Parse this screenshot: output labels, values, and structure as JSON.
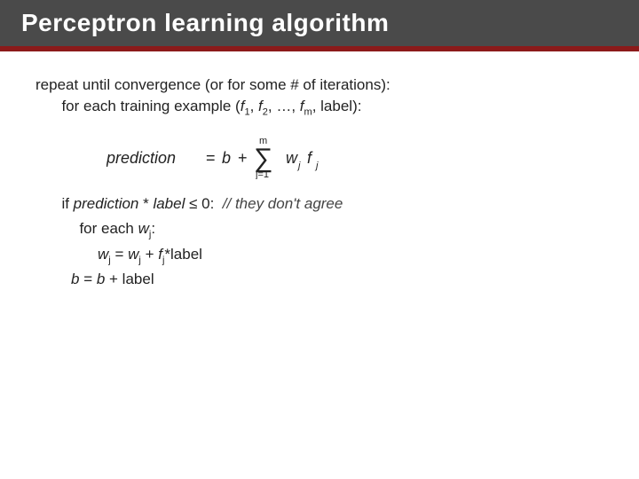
{
  "title": "Perceptron learning algorithm",
  "accent_color": "#8b1a1a",
  "title_bar_color": "#4a4a4a",
  "content": {
    "line1": "repeat until convergence (or for some # of iterations):",
    "line2": "for each training example (f",
    "line2_subs": [
      "1",
      "2",
      "m"
    ],
    "line2_rest": ", label):",
    "formula_label": "prediction",
    "formula_equals": "= b +",
    "formula_sum": "∑",
    "formula_sum_sub": "j=1",
    "formula_sum_sup": "m",
    "formula_sum_body": "w",
    "formula_sum_body_sub": "j",
    "formula_sum_body2": "f",
    "formula_sum_body2_sub": "j",
    "if_line": "if prediction * label ≤ 0:  // they don't agree",
    "for_each_line": "for each w",
    "for_each_sub": "j",
    "update_wj": "w",
    "update_wj_sub": "j",
    "update_wj_rest": " = w",
    "update_wj_sub2": "j",
    "update_wj_tail": " + f",
    "update_fj_sub": "j",
    "update_fj_tail": "*label",
    "b_line": "b = b + label",
    "comment_text": "// they don't agree"
  }
}
